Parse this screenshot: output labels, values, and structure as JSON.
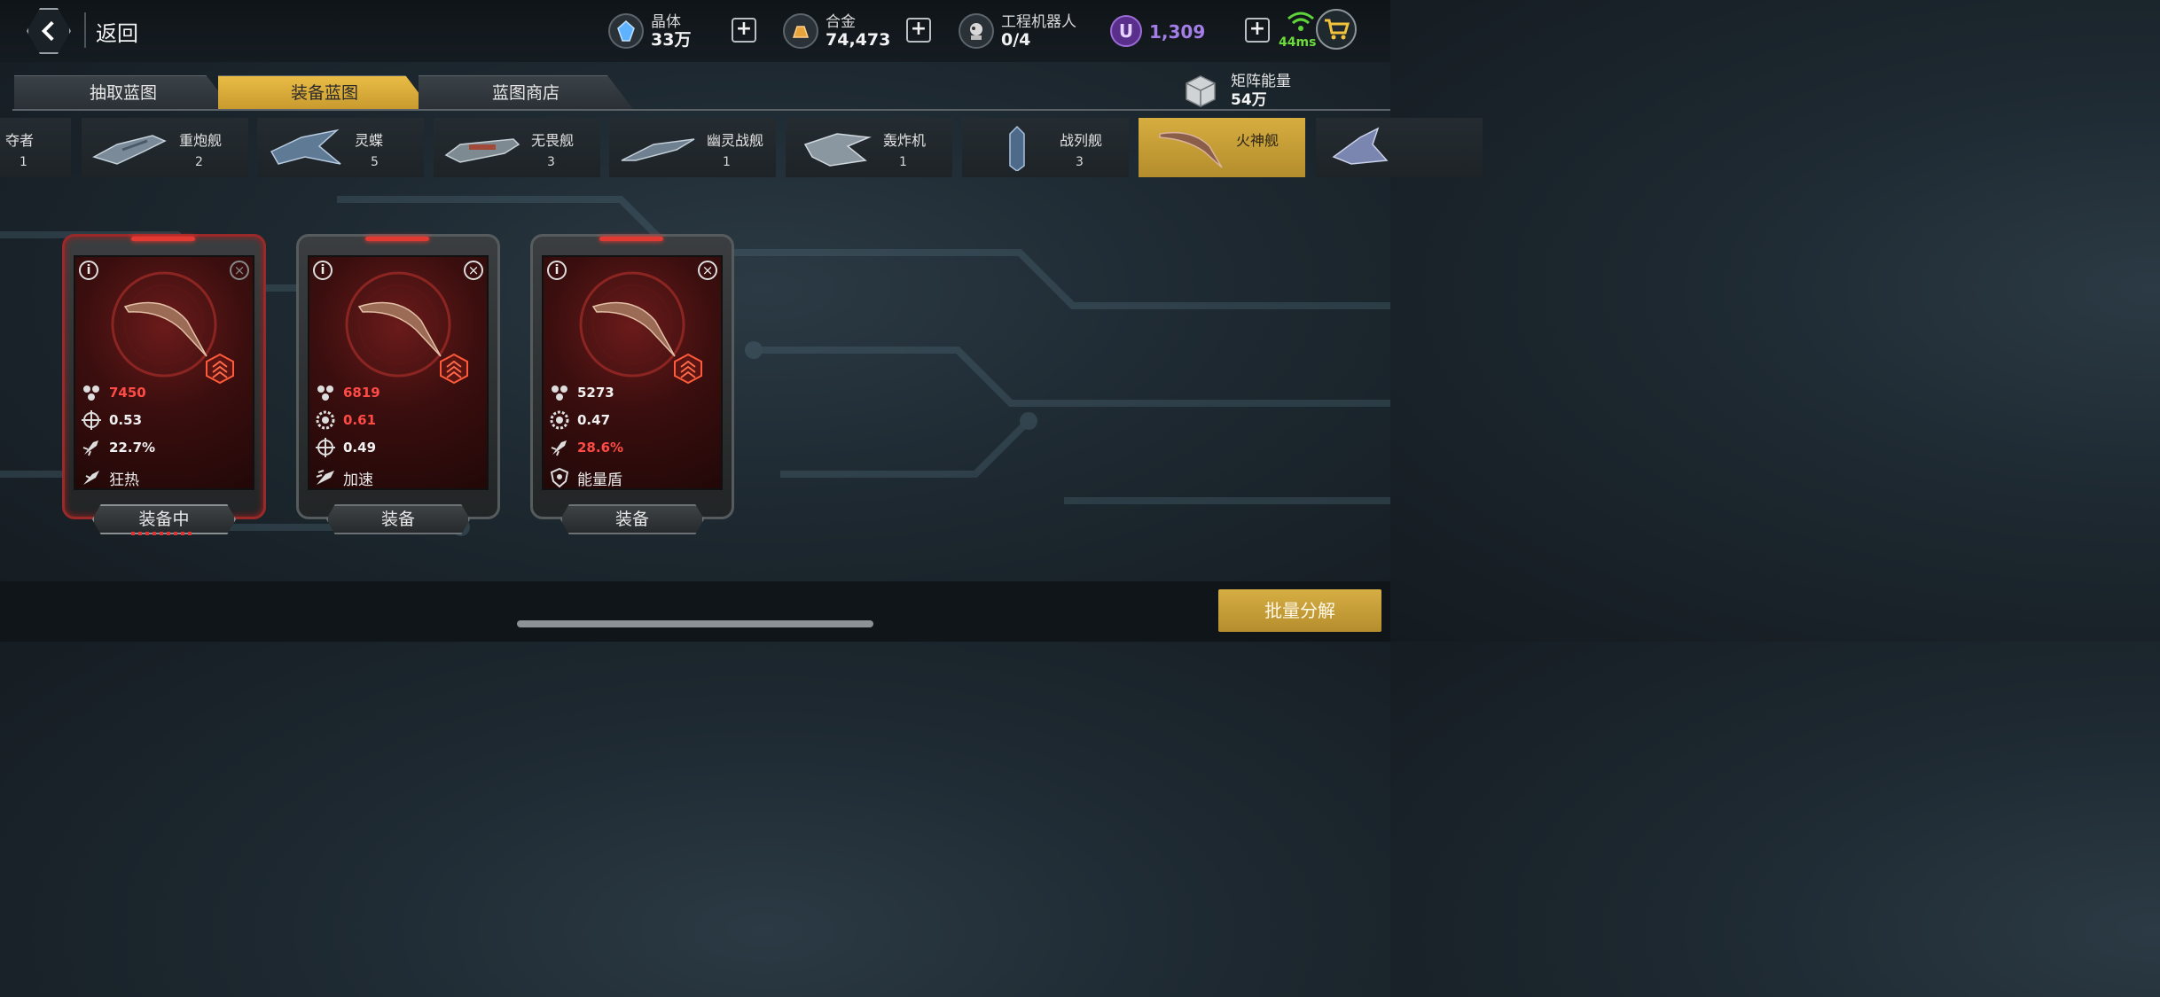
{
  "header": {
    "back_label": "返回",
    "resources": [
      {
        "name": "晶体",
        "value": "33万",
        "icon": "crystal-icon"
      },
      {
        "name": "合金",
        "value": "74,473",
        "icon": "alloy-icon"
      },
      {
        "name": "工程机器人",
        "value": "0/4",
        "icon": "robot-icon"
      }
    ],
    "premium_currency": {
      "symbol": "U",
      "value": "1,309",
      "color": "#a37ee6"
    },
    "ping": "44ms"
  },
  "tabs": [
    {
      "label": "抽取蓝图",
      "active": false
    },
    {
      "label": "装备蓝图",
      "active": true
    },
    {
      "label": "蓝图商店",
      "active": false
    }
  ],
  "matrix_energy": {
    "name": "矩阵能量",
    "value": "54万"
  },
  "ship_types": [
    {
      "name": "掠夺者",
      "count": "1",
      "active": false
    },
    {
      "name": "重炮舰",
      "count": "2",
      "active": false
    },
    {
      "name": "灵蝶",
      "count": "5",
      "active": false
    },
    {
      "name": "无畏舰",
      "count": "3",
      "active": false
    },
    {
      "name": "幽灵战舰",
      "count": "1",
      "active": false
    },
    {
      "name": "轰炸机",
      "count": "1",
      "active": false
    },
    {
      "name": "战列舰",
      "count": "3",
      "active": false
    },
    {
      "name": "火神舰",
      "count": "",
      "active": true
    }
  ],
  "ship_types_visible_partial_first": "夺者",
  "cards": [
    {
      "equipped": true,
      "stats": [
        {
          "icon": "hp-icon",
          "value": "7450",
          "highlight": true
        },
        {
          "icon": "crosshair-icon",
          "value": "0.53",
          "highlight": false
        },
        {
          "icon": "missile-icon",
          "value": "22.7%",
          "highlight": false
        }
      ],
      "skill": {
        "icon": "frenzy-icon",
        "label": "狂热"
      },
      "button_label": "装备中"
    },
    {
      "equipped": false,
      "stats": [
        {
          "icon": "hp-icon",
          "value": "6819",
          "highlight": true
        },
        {
          "icon": "gear-target-icon",
          "value": "0.61",
          "highlight": true
        },
        {
          "icon": "crosshair-icon",
          "value": "0.49",
          "highlight": false
        }
      ],
      "skill": {
        "icon": "boost-icon",
        "label": "加速"
      },
      "button_label": "装备"
    },
    {
      "equipped": false,
      "stats": [
        {
          "icon": "hp-icon",
          "value": "5273",
          "highlight": false
        },
        {
          "icon": "gear-target-icon",
          "value": "0.47",
          "highlight": false
        },
        {
          "icon": "missile-icon",
          "value": "28.6%",
          "highlight": true
        }
      ],
      "skill": {
        "icon": "shield-icon",
        "label": "能量盾"
      },
      "button_label": "装备"
    }
  ],
  "footer": {
    "bulk_button_label": "批量分解"
  },
  "colors": {
    "accent_gold": "#d6ae44",
    "highlight_red": "#ff4b45",
    "card_red": "#6a1b1a"
  }
}
